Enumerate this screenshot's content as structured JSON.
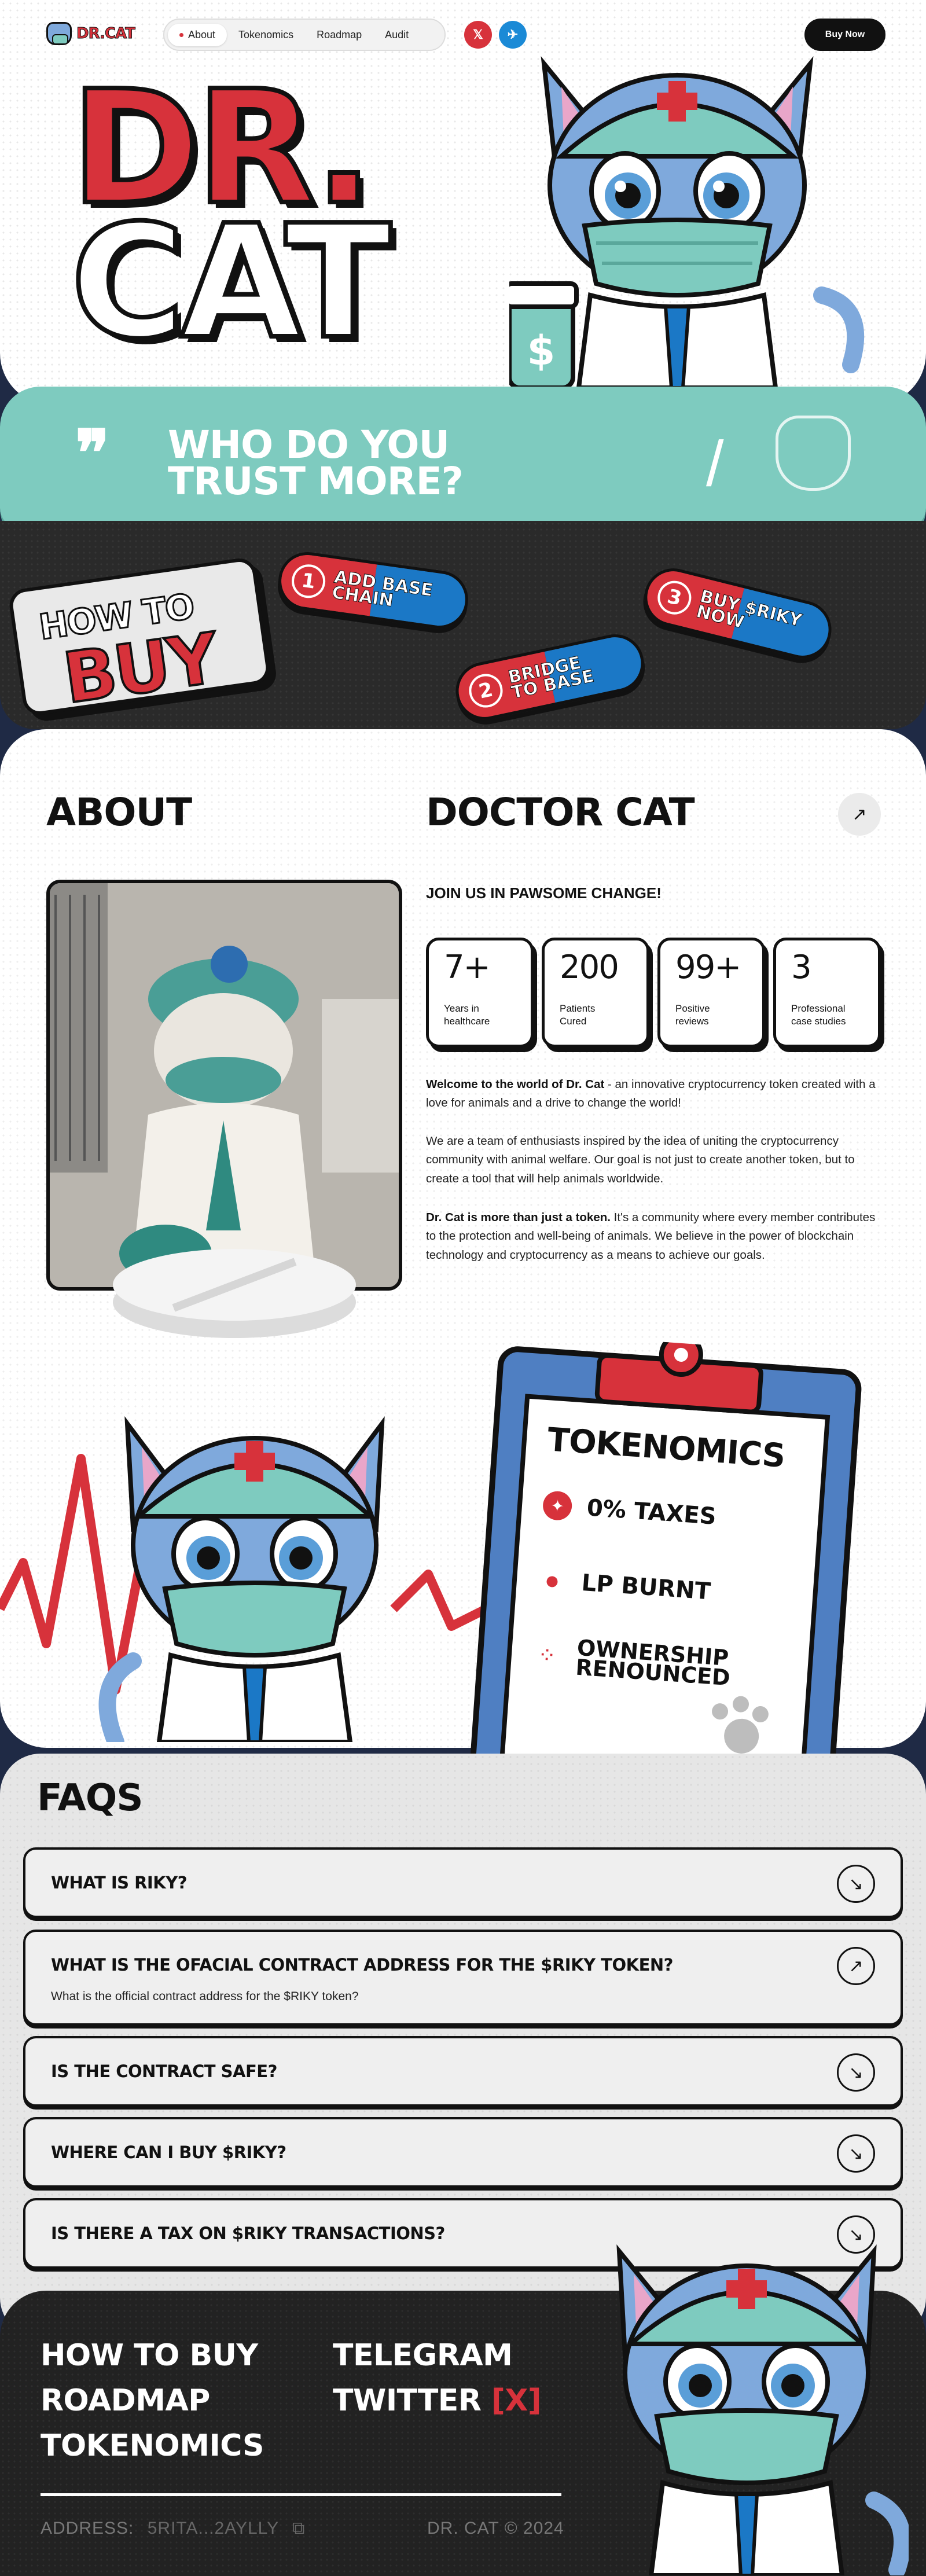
{
  "nav": {
    "brand": "DR.CAT",
    "items": [
      {
        "label": "About",
        "active": true
      },
      {
        "label": "Tokenomics"
      },
      {
        "label": "Roadmap"
      },
      {
        "label": "Audit"
      }
    ],
    "social": [
      {
        "icon": "x-icon",
        "glyph": "𝕏",
        "color": "#d7323b"
      },
      {
        "icon": "telegram-icon",
        "glyph": "✈",
        "color": "#1b8ad6"
      }
    ],
    "buy_label": "Buy Now"
  },
  "hero": {
    "title_line1": "DR.",
    "title_line2": "CAT"
  },
  "banner": {
    "quote_mark": "❞",
    "headline_line1": "WHO DO YOU",
    "headline_line2": "TRUST MORE?",
    "slash": "/"
  },
  "how_to_buy": {
    "label_line1": "HOW TO",
    "label_line2": "BUY",
    "steps": [
      {
        "number": "1",
        "text_line1": "ADD BASE",
        "text_line2": "CHAIN"
      },
      {
        "number": "2",
        "text_line1": "BRIDGE",
        "text_line2": "TO BASE"
      },
      {
        "number": "3",
        "text_line1": "BUY $RIKY",
        "text_line2": "NOW"
      }
    ]
  },
  "about": {
    "heading": "ABOUT",
    "subheading": "DOCTOR CAT",
    "join": "JOIN US IN PAWSOME CHANGE!",
    "stats": [
      {
        "value": "7+",
        "label_line1": "Years in",
        "label_line2": "healthcare"
      },
      {
        "value": "200",
        "label_line1": "Patients",
        "label_line2": "Cured"
      },
      {
        "value": "99+",
        "label_line1": "Positive",
        "label_line2": "reviews"
      },
      {
        "value": "3",
        "label_line1": "Professional",
        "label_line2": "case studies"
      }
    ],
    "p1_bold": "Welcome to the world of Dr. Cat",
    "p1_rest": " - an innovative cryptocurrency token created with a love for animals and a drive to change the world!",
    "p2": "We are a team of enthusiasts inspired by the idea of uniting the cryptocurrency community with animal welfare. Our goal is not just to create another token, but to create a tool that will help animals worldwide.",
    "p3_bold": "Dr. Cat is more than just a token.",
    "p3_rest": " It's a community where every member contributes to the protection and well-being of animals. We believe in the power of blockchain technology and cryptocurrency as a means to achieve our goals."
  },
  "tokenomics": {
    "heading": "TOKENOMICS",
    "items": [
      {
        "icon": "badge-icon",
        "label": "0% TAXES"
      },
      {
        "icon": "drop-icon",
        "label": "LP BURNT"
      },
      {
        "icon": "pills-icon",
        "label_line1": "OWNERSHIP",
        "label_line2": "RENOUNCED"
      }
    ]
  },
  "faqs": {
    "heading": "FAQS",
    "items": [
      {
        "q": "WHAT IS RIKY?",
        "a": "",
        "open": false
      },
      {
        "q": "WHAT IS THE OFACIAL CONTRACT ADDRESS FOR THE $RIKY TOKEN?",
        "a": "What is the official contract address for the $RIKY token?",
        "open": true
      },
      {
        "q": "IS THE CONTRACT SAFE?",
        "a": "",
        "open": false
      },
      {
        "q": "WHERE CAN I BUY $RIKY?",
        "a": "",
        "open": false
      },
      {
        "q": "IS THERE A TAX ON $RIKY TRANSACTIONS?",
        "a": "",
        "open": false
      }
    ]
  },
  "footer": {
    "links_left": [
      "HOW TO BUY",
      "ROADMAP",
      "TOKENOMICS"
    ],
    "links_right": [
      "TELEGRAM",
      "TWITTER"
    ],
    "twitter_badge": "X",
    "address_label": "ADDRESS:",
    "address_value": "5RITA...2AYLLY",
    "copyright": "DR. CAT © 2024"
  },
  "colors": {
    "red": "#d7323b",
    "blue": "#1b78c6",
    "teal": "#7ecbbf",
    "navy": "#1f2a45",
    "dark": "#222222"
  }
}
